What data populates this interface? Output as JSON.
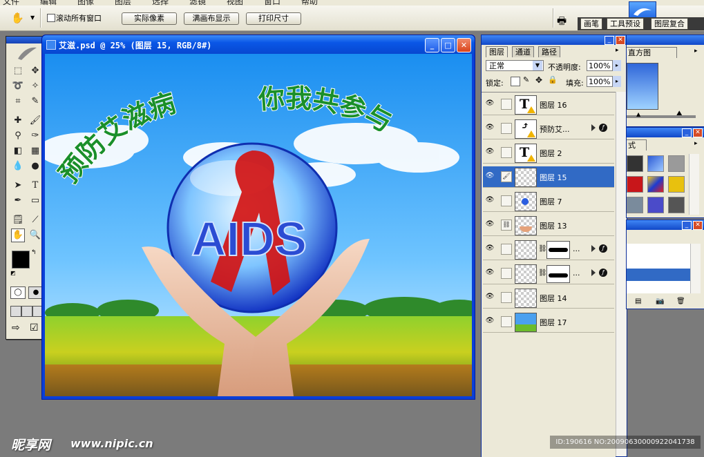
{
  "menu": {
    "items": [
      "文件",
      "编辑",
      "图像",
      "图层",
      "选择",
      "滤镜",
      "视图",
      "窗口",
      "帮助"
    ]
  },
  "options_bar": {
    "scroll_all_label": "滚动所有窗口",
    "actual_pixels_label": "实际像素",
    "fit_screen_label": "满画布显示",
    "print_size_label": "打印尺寸",
    "well_tabs": [
      "画笔",
      "工具预设",
      "图层复合"
    ]
  },
  "document": {
    "title": "艾滋.psd @ 25% (图层 15, RGB/8#)",
    "canvas": {
      "slogan_left": "预防艾滋病",
      "slogan_right": "你我共参与",
      "logo_text": "AIDS"
    }
  },
  "layers_panel": {
    "tabs": [
      "图层",
      "通道",
      "路径"
    ],
    "blend_mode": "正常",
    "opacity_label": "不透明度:",
    "opacity_value": "100%",
    "lock_label": "锁定:",
    "fill_label": "填充:",
    "fill_value": "100%",
    "layers": [
      {
        "name": "图层 16",
        "kind": "type"
      },
      {
        "name": "预防艾...",
        "kind": "smart",
        "fx": true
      },
      {
        "name": "图层 2",
        "kind": "type"
      },
      {
        "name": "图层 15",
        "kind": "pixel",
        "selected": true
      },
      {
        "name": "图层 7",
        "kind": "pixel"
      },
      {
        "name": "图层 13",
        "kind": "pixel"
      },
      {
        "name": "...",
        "kind": "masked",
        "fx": true
      },
      {
        "name": "...",
        "kind": "masked",
        "fx": true
      },
      {
        "name": "图层 14",
        "kind": "pixel"
      },
      {
        "name": "图层 17",
        "kind": "pixel"
      }
    ]
  },
  "histogram_panel": {
    "title": "直方图"
  },
  "styles_panel": {
    "title": "式"
  },
  "watermark": {
    "site_name": "昵享网",
    "url": "www.nipic.cn",
    "id_text": "ID:190616 NO:20090630000922041738"
  },
  "colors": {
    "accent": "#316ac5",
    "titlebar": "#0a57e6",
    "panel_bg": "#ece9d8"
  }
}
